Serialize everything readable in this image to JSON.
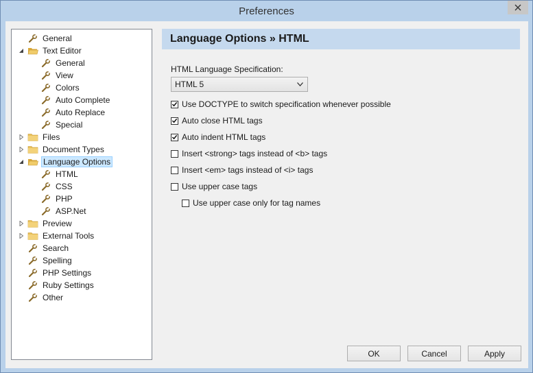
{
  "window": {
    "title": "Preferences"
  },
  "tree": [
    {
      "label": "General",
      "depth": 0,
      "kind": "leaf"
    },
    {
      "label": "Text Editor",
      "depth": 0,
      "kind": "folder-open",
      "expanded": true
    },
    {
      "label": "General",
      "depth": 1,
      "kind": "leaf"
    },
    {
      "label": "View",
      "depth": 1,
      "kind": "leaf"
    },
    {
      "label": "Colors",
      "depth": 1,
      "kind": "leaf"
    },
    {
      "label": "Auto Complete",
      "depth": 1,
      "kind": "leaf"
    },
    {
      "label": "Auto Replace",
      "depth": 1,
      "kind": "leaf"
    },
    {
      "label": "Special",
      "depth": 1,
      "kind": "leaf"
    },
    {
      "label": "Files",
      "depth": 0,
      "kind": "folder",
      "expanded": false
    },
    {
      "label": "Document Types",
      "depth": 0,
      "kind": "folder",
      "expanded": false
    },
    {
      "label": "Language Options",
      "depth": 0,
      "kind": "folder-open",
      "expanded": true,
      "selected": true
    },
    {
      "label": "HTML",
      "depth": 1,
      "kind": "leaf"
    },
    {
      "label": "CSS",
      "depth": 1,
      "kind": "leaf"
    },
    {
      "label": "PHP",
      "depth": 1,
      "kind": "leaf"
    },
    {
      "label": "ASP.Net",
      "depth": 1,
      "kind": "leaf"
    },
    {
      "label": "Preview",
      "depth": 0,
      "kind": "folder",
      "expanded": false
    },
    {
      "label": "External Tools",
      "depth": 0,
      "kind": "folder",
      "expanded": false
    },
    {
      "label": "Search",
      "depth": 0,
      "kind": "leaf"
    },
    {
      "label": "Spelling",
      "depth": 0,
      "kind": "leaf"
    },
    {
      "label": "PHP Settings",
      "depth": 0,
      "kind": "leaf"
    },
    {
      "label": "Ruby Settings",
      "depth": 0,
      "kind": "leaf"
    },
    {
      "label": "Other",
      "depth": 0,
      "kind": "leaf"
    }
  ],
  "panel": {
    "title": "Language Options » HTML",
    "spec_label": "HTML Language Specification:",
    "spec_value": "HTML 5",
    "options": [
      {
        "label": "Use DOCTYPE to switch specification whenever possible",
        "checked": true,
        "indent": 0
      },
      {
        "label": "Auto close HTML tags",
        "checked": true,
        "indent": 0
      },
      {
        "label": "Auto indent HTML tags",
        "checked": true,
        "indent": 0
      },
      {
        "label": "Insert <strong> tags instead of <b> tags",
        "checked": false,
        "indent": 0
      },
      {
        "label": "Insert <em> tags instead of <i> tags",
        "checked": false,
        "indent": 0
      },
      {
        "label": "Use upper case tags",
        "checked": false,
        "indent": 0
      },
      {
        "label": "Use upper case only for tag names",
        "checked": false,
        "indent": 1
      }
    ]
  },
  "buttons": {
    "ok": "OK",
    "cancel": "Cancel",
    "apply": "Apply"
  },
  "colors": {
    "titlebar": "#b9d1ea",
    "panel_header": "#c5d9ee",
    "selection": "#cce8ff",
    "folder": "#e8c15a"
  }
}
